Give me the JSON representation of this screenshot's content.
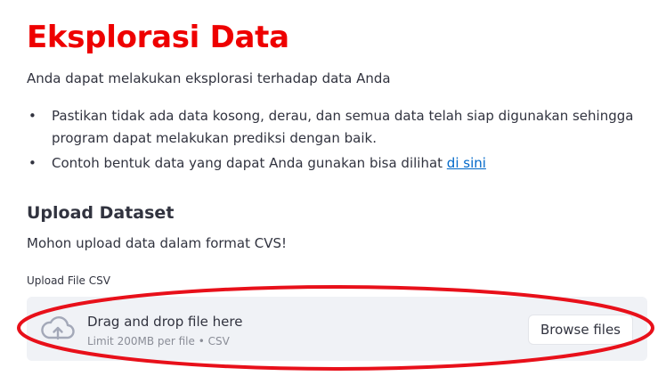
{
  "page": {
    "title": "Eksplorasi Data",
    "subtitle": "Anda dapat melakukan eksplorasi terhadap data Anda",
    "bullets": [
      {
        "text": "Pastikan tidak ada data kosong, derau, dan semua data telah siap digunakan sehingga program dapat melakukan prediksi dengan baik."
      },
      {
        "text": "Contoh bentuk data yang dapat Anda gunakan bisa dilihat ",
        "link": "di sini"
      }
    ],
    "bullet_glyph": "•",
    "section_heading": "Upload Dataset",
    "section_note": "Mohon upload data dalam format CVS!"
  },
  "uploader": {
    "label": "Upload File CSV",
    "drop_text": "Drag and drop file here",
    "limit_text": "Limit 200MB per file • CSV",
    "browse_label": "Browse files",
    "icon": "cloud-upload-icon"
  },
  "colors": {
    "title": "#ee0000",
    "text": "#31333f",
    "link": "#0068c9",
    "dropzone_bg": "#f0f2f6",
    "annotation": "#e8101a"
  }
}
